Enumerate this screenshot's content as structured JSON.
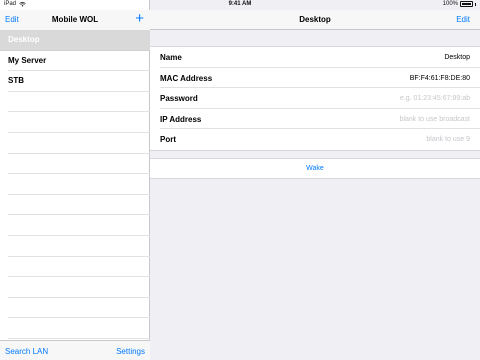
{
  "status_bar": {
    "device": "iPad",
    "time": "9:41 AM",
    "battery": "100%"
  },
  "master": {
    "nav": {
      "edit_label": "Edit",
      "title": "Mobile WOL",
      "add_label": "+"
    },
    "items": [
      "Desktop",
      "My Server",
      "STB"
    ],
    "toolbar": {
      "search_label": "Search LAN",
      "settings_label": "Settings"
    }
  },
  "detail": {
    "nav": {
      "title": "Desktop",
      "edit_label": "Edit"
    },
    "fields": {
      "name": {
        "label": "Name",
        "value": "Desktop"
      },
      "mac": {
        "label": "MAC Address",
        "value": "BF:F4:61:F8:DE:80"
      },
      "password": {
        "label": "Password",
        "placeholder": "e.g. 01:23:45:67:89:ab"
      },
      "ip": {
        "label": "IP Address",
        "placeholder": "blank to use broadcast"
      },
      "port": {
        "label": "Port",
        "placeholder": "blank to use 9"
      }
    },
    "wake_label": "Wake"
  },
  "colors": {
    "accent": "#007aff",
    "selected_row": "#d9d9d9",
    "background": "#efeff4"
  }
}
